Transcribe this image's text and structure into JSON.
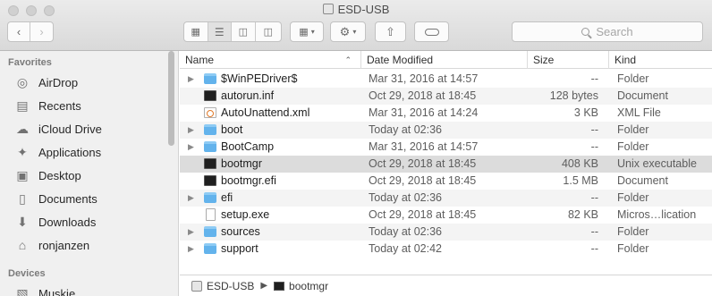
{
  "window": {
    "title": "ESD-USB"
  },
  "toolbar": {
    "back_icon": "chevron-left-icon",
    "forward_icon": "chevron-right-icon",
    "view_modes": [
      "icon-view",
      "list-view",
      "column-view",
      "cover-flow-view"
    ],
    "active_view": "list-view",
    "search_placeholder": "Search"
  },
  "sidebar": {
    "favorites_heading": "Favorites",
    "devices_heading": "Devices",
    "favorites": [
      {
        "label": "AirDrop",
        "icon": "airdrop-icon"
      },
      {
        "label": "Recents",
        "icon": "recents-icon"
      },
      {
        "label": "iCloud Drive",
        "icon": "cloud-icon"
      },
      {
        "label": "Applications",
        "icon": "applications-icon"
      },
      {
        "label": "Desktop",
        "icon": "desktop-icon"
      },
      {
        "label": "Documents",
        "icon": "documents-icon"
      },
      {
        "label": "Downloads",
        "icon": "downloads-icon"
      },
      {
        "label": "ronjanzen",
        "icon": "home-icon"
      }
    ],
    "devices": [
      {
        "label": "Muskie",
        "icon": "computer-icon"
      }
    ]
  },
  "list": {
    "columns": {
      "name": "Name",
      "date": "Date Modified",
      "size": "Size",
      "kind": "Kind"
    },
    "sort_column": "Name",
    "sort_direction": "ascending",
    "rows": [
      {
        "name": "$WinPEDriver$",
        "date": "Mar 31, 2016 at 14:57",
        "size": "--",
        "kind": "Folder",
        "type": "folder",
        "expandable": true
      },
      {
        "name": "autorun.inf",
        "date": "Oct 29, 2018 at 18:45",
        "size": "128 bytes",
        "kind": "Document",
        "type": "exec",
        "expandable": false
      },
      {
        "name": "AutoUnattend.xml",
        "date": "Mar 31, 2016 at 14:24",
        "size": "3 KB",
        "kind": "XML File",
        "type": "xml",
        "expandable": false
      },
      {
        "name": "boot",
        "date": "Today at 02:36",
        "size": "--",
        "kind": "Folder",
        "type": "folder",
        "expandable": true
      },
      {
        "name": "BootCamp",
        "date": "Mar 31, 2016 at 14:57",
        "size": "--",
        "kind": "Folder",
        "type": "folder",
        "expandable": true
      },
      {
        "name": "bootmgr",
        "date": "Oct 29, 2018 at 18:45",
        "size": "408 KB",
        "kind": "Unix executable",
        "type": "exec",
        "expandable": false,
        "selected": true
      },
      {
        "name": "bootmgr.efi",
        "date": "Oct 29, 2018 at 18:45",
        "size": "1.5 MB",
        "kind": "Document",
        "type": "exec",
        "expandable": false
      },
      {
        "name": "efi",
        "date": "Today at 02:36",
        "size": "--",
        "kind": "Folder",
        "type": "folder",
        "expandable": true
      },
      {
        "name": "setup.exe",
        "date": "Oct 29, 2018 at 18:45",
        "size": "82 KB",
        "kind": "Micros…lication",
        "type": "doc",
        "expandable": false
      },
      {
        "name": "sources",
        "date": "Today at 02:36",
        "size": "--",
        "kind": "Folder",
        "type": "folder",
        "expandable": true
      },
      {
        "name": "support",
        "date": "Today at 02:42",
        "size": "--",
        "kind": "Folder",
        "type": "folder",
        "expandable": true
      }
    ]
  },
  "pathbar": {
    "items": [
      "ESD-USB",
      "bootmgr"
    ]
  },
  "colors": {
    "folder_blue": "#63b3ec",
    "selection_gray": "#dcdcdc"
  }
}
